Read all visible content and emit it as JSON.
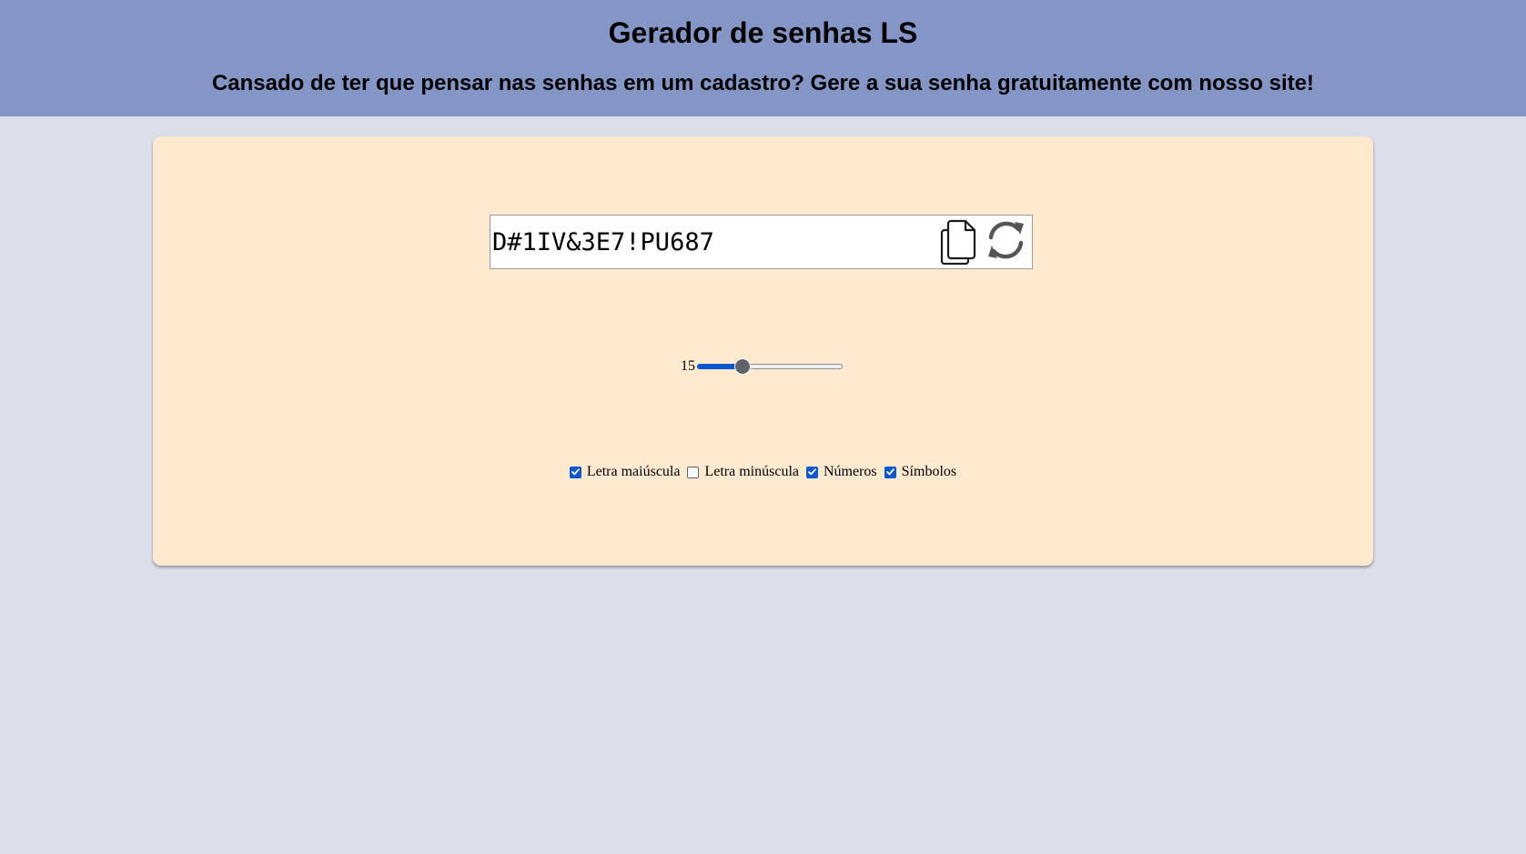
{
  "header": {
    "title": "Gerador de senhas LS",
    "subtitle": "Cansado de ter que pensar nas senhas em um cadastro? Gere a sua senha gratuitamente com nosso site!"
  },
  "password": {
    "value": "D#1IV&3E7!PU687"
  },
  "icons": {
    "copy": "copy-icon",
    "refresh": "refresh-icon"
  },
  "length": {
    "value": "15",
    "fill_fraction": 0.31
  },
  "options": [
    {
      "label": "Letra maiúscula",
      "checked": true
    },
    {
      "label": "Letra minúscula",
      "checked": false
    },
    {
      "label": "Números",
      "checked": true
    },
    {
      "label": "Símbolos",
      "checked": true
    }
  ],
  "colors": {
    "header_bg": "#8496c6",
    "page_bg": "#dcdfea",
    "card_bg": "#ffe9cf",
    "accent": "#0b57d0"
  }
}
